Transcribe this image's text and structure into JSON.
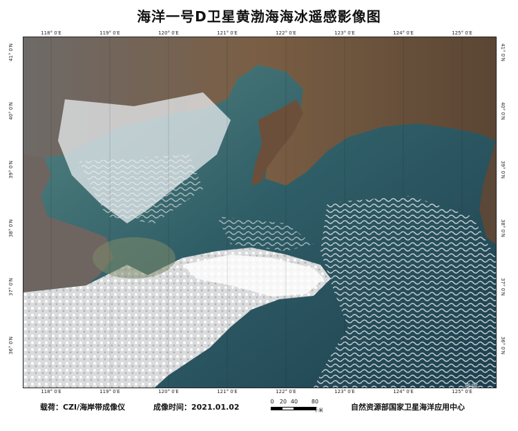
{
  "title": "海洋一号D卫星黄渤海海冰遥感影像图",
  "graticule": {
    "top_lon": [
      "118° 0′E",
      "119° 0′E",
      "120° 0′E",
      "121° 0′E",
      "122° 0′E",
      "123° 0′E",
      "124° 0′E",
      "125° 0′E"
    ],
    "bottom_lon": [
      "118° 0′E",
      "119° 0′E",
      "120° 0′E",
      "121° 0′E",
      "122° 0′E",
      "123° 0′E",
      "124° 0′E",
      "125° 0′E"
    ],
    "left_lat": [
      "41° 0′N",
      "40° 0′N",
      "39° 0′N",
      "38° 0′N",
      "37° 0′N",
      "36° 0′N"
    ],
    "right_lat": [
      "41° 0′N",
      "40° 0′N",
      "39° 0′N",
      "38° 0′N",
      "37° 0′N",
      "36° 0′N"
    ]
  },
  "footer": {
    "payload": "载荷：CZI/海岸带成像仪",
    "time": "成像时间：2021.01.02",
    "agency": "自然资源部国家卫星海洋应用中心"
  },
  "scale": {
    "labels": [
      "0",
      "20",
      "40",
      "80"
    ],
    "unit": "千米"
  },
  "watermark": "奥需"
}
